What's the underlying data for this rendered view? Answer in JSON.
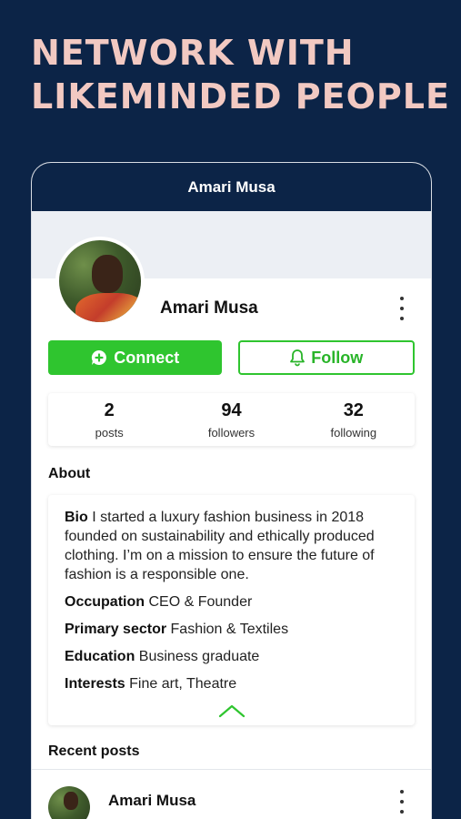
{
  "headline": {
    "line1": "NETWORK WITH",
    "line2": "LIKEMINDED PEOPLE"
  },
  "header": {
    "title": "Amari Musa"
  },
  "profile": {
    "name": "Amari Musa",
    "more_icon": "more-vertical-icon"
  },
  "actions": {
    "connect_label": "Connect",
    "connect_icon": "chat-plus-icon",
    "follow_label": "Follow",
    "follow_icon": "bell-icon"
  },
  "stats": [
    {
      "value": "2",
      "label": "posts"
    },
    {
      "value": "94",
      "label": "followers"
    },
    {
      "value": "32",
      "label": "following"
    }
  ],
  "about": {
    "title": "About",
    "bio_label": "Bio",
    "bio_text": "I started a luxury fashion business in 2018 founded on sustainability and ethically produced clothing. I’m on a mission to ensure the future of fashion is a responsible one.",
    "fields": [
      {
        "label": "Occupation",
        "value": "CEO & Founder"
      },
      {
        "label": "Primary sector",
        "value": "Fashion & Textiles"
      },
      {
        "label": "Education",
        "value": "Business graduate"
      },
      {
        "label": "Interests",
        "value": "Fine art, Theatre"
      }
    ],
    "collapse_icon": "chevron-up-icon"
  },
  "recent_posts": {
    "title": "Recent posts",
    "items": [
      {
        "author": "Amari Musa"
      }
    ]
  },
  "colors": {
    "background": "#0c2447",
    "headline": "#f2c9c2",
    "accent_green": "#2fc52f"
  }
}
